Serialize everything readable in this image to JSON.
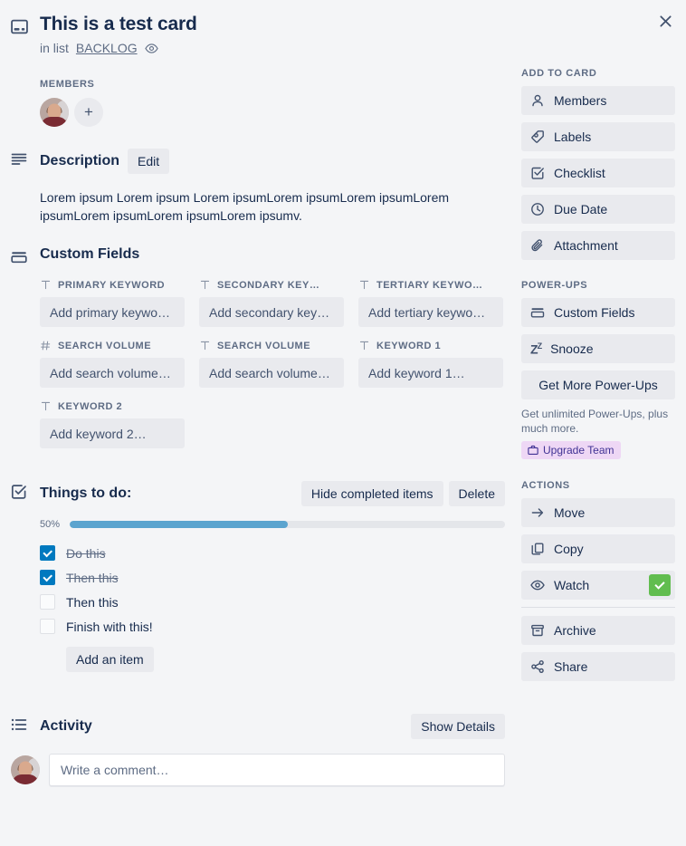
{
  "header": {
    "card_icon": "card-icon",
    "title": "This is a test card",
    "in_list_prefix": "in list",
    "list_name": "BACKLOG",
    "watch_eye_icon": "eye-icon",
    "close_icon": "close-icon"
  },
  "members": {
    "label": "MEMBERS",
    "add_symbol": "+"
  },
  "description": {
    "title": "Description",
    "edit_label": "Edit",
    "body": "Lorem ipsum Lorem ipsum Lorem ipsumLorem ipsumLorem ipsumLorem ipsumLorem ipsumLorem ipsumLorem ipsumv."
  },
  "custom_fields": {
    "title": "Custom Fields",
    "fields": [
      {
        "label": "PRIMARY KEYWORD",
        "type_icon": "text",
        "placeholder": "Add primary keywo…"
      },
      {
        "label": "SECONDARY KEY…",
        "type_icon": "text",
        "placeholder": "Add secondary key…"
      },
      {
        "label": "TERTIARY KEYWO…",
        "type_icon": "text",
        "placeholder": "Add tertiary keywo…"
      },
      {
        "label": "SEARCH VOLUME",
        "type_icon": "number",
        "placeholder": "Add search volume…"
      },
      {
        "label": "SEARCH VOLUME",
        "type_icon": "text",
        "placeholder": "Add search volume…"
      },
      {
        "label": "KEYWORD 1",
        "type_icon": "text",
        "placeholder": "Add keyword 1…"
      },
      {
        "label": "KEYWORD 2",
        "type_icon": "text",
        "placeholder": "Add keyword 2…"
      }
    ]
  },
  "checklist": {
    "title": "Things to do:",
    "hide_completed_label": "Hide completed items",
    "delete_label": "Delete",
    "percent_label": "50%",
    "percent_value": 50,
    "items": [
      {
        "label": "Do this",
        "checked": true
      },
      {
        "label": "Then this",
        "checked": true
      },
      {
        "label": "Then this",
        "checked": false
      },
      {
        "label": "Finish with this!",
        "checked": false
      }
    ],
    "add_item_label": "Add an item"
  },
  "activity": {
    "title": "Activity",
    "show_details_label": "Show Details",
    "comment_placeholder": "Write a comment…"
  },
  "sidebar": {
    "add_to_card": {
      "label": "ADD TO CARD",
      "items": [
        {
          "label": "Members",
          "icon": "person-icon"
        },
        {
          "label": "Labels",
          "icon": "label-tag-icon"
        },
        {
          "label": "Checklist",
          "icon": "checklist-icon"
        },
        {
          "label": "Due Date",
          "icon": "clock-icon"
        },
        {
          "label": "Attachment",
          "icon": "paperclip-icon"
        }
      ]
    },
    "power_ups": {
      "label": "POWER-UPS",
      "items": [
        {
          "label": "Custom Fields",
          "icon": "custom-fields-icon"
        },
        {
          "label": "Snooze",
          "icon": "snooze-zz-icon"
        }
      ],
      "get_more_label": "Get More Power-Ups",
      "note": "Get unlimited Power-Ups, plus much more.",
      "upgrade_label": "Upgrade Team",
      "upgrade_icon": "briefcase-icon",
      "upgrade_bg": "#eed7f5",
      "upgrade_fg": "#403294"
    },
    "actions": {
      "label": "ACTIONS",
      "items": [
        {
          "label": "Move",
          "icon": "arrow-right-icon",
          "badge": false
        },
        {
          "label": "Copy",
          "icon": "copy-icon",
          "badge": false
        },
        {
          "label": "Watch",
          "icon": "eye-icon",
          "badge": true
        }
      ],
      "items_after_divider": [
        {
          "label": "Archive",
          "icon": "archive-box-icon"
        },
        {
          "label": "Share",
          "icon": "share-icon"
        }
      ]
    }
  },
  "colors": {
    "page_bg": "#f4f5f7",
    "text": "#172b4d",
    "muted": "#5e6c84",
    "button_bg": "#e9eaee",
    "progress_fill": "#5ba4cf",
    "checkbox_checked": "#0079bf",
    "watch_badge_green": "#61bd4f"
  }
}
